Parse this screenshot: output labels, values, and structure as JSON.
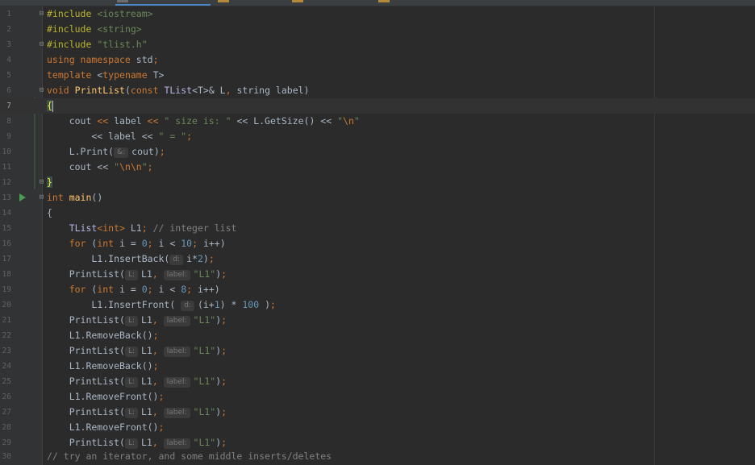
{
  "editor": {
    "tabs": [
      {
        "active": true
      },
      {
        "active": false
      },
      {
        "active": false
      },
      {
        "active": false
      }
    ],
    "colors": {
      "background": "#2b2b2b",
      "keyword": "#cc7832",
      "string": "#6a8759",
      "number": "#6897bb",
      "function": "#ffc66d",
      "comment": "#808080",
      "preprocessor": "#bbb529"
    },
    "line_numbers": [
      "1",
      "2",
      "3",
      "4",
      "5",
      "6",
      "7",
      "8",
      "9",
      "10",
      "11",
      "12",
      "13",
      "14",
      "15",
      "16",
      "17",
      "18",
      "19",
      "20",
      "21",
      "22",
      "23",
      "24",
      "25",
      "26",
      "27",
      "28",
      "29",
      "30"
    ],
    "current_line": "7",
    "run_icon_line": "13",
    "run_icon": "run-play-icon",
    "fold_icon": "fold-icon",
    "hints": {
      "os": "&:",
      "d": "d:",
      "L": "L:",
      "label": "label:"
    },
    "code": {
      "l1_directive": "#include",
      "l1_arg": "<iostream>",
      "l2_directive": "#include",
      "l2_arg": "<string>",
      "l3_directive": "#include",
      "l3_arg": "\"tlist.h\"",
      "l4_kw": "using namespace",
      "l4_rest": " std",
      "l4_semi": ";",
      "l5_kw": "template",
      "l5_open": " <",
      "l5_tn": "typename",
      "l5_rest": " T>",
      "l6_kw": "void",
      "l6_fn": "PrintList",
      "l6_p1": "(",
      "l6_const": "const",
      "l6_type": " TList",
      "l6_tmpl": "<T>& L",
      "l6_comma": ",",
      "l6_rest": " string label)",
      "l7_brace": "{",
      "l8_a": "    cout ",
      "l8_op1": "<<",
      "l8_b": " label ",
      "l8_op2": "<<",
      "l8_str": " \" size is: \"",
      "l8_c": " << L.GetSize() << ",
      "l8_str2a": "\"",
      "l8_esc": "\\n",
      "l8_str2b": "\"",
      "l9_a": "        << label << ",
      "l9_str": "\" = \"",
      "l9_semi": ";",
      "l10_a": "    L.Print(",
      "l10_b": "cout)",
      "l10_semi": ";",
      "l11_a": "    cout << ",
      "l11_q1": "\"",
      "l11_esc": "\\n\\n",
      "l11_q2": "\"",
      "l11_semi": ";",
      "l12_brace": "}",
      "l13_kw": "int",
      "l13_fn": " main",
      "l13_rest": "()",
      "l14_brace": "{",
      "l15_a": "    TList",
      "l15_tmpl": "<int>",
      "l15_b": " L1",
      "l15_semi": ";",
      "l15_cmt": " // integer list",
      "l16_kw": "    for",
      "l16_a": " (",
      "l16_int": "int",
      "l16_b": " i = ",
      "l16_n0": "0",
      "l16_s1": ";",
      "l16_c": " i < ",
      "l16_n10": "10",
      "l16_s2": ";",
      "l16_d": " i++)",
      "l17_a": "        L1.InsertBack(",
      "l17_b": "i*",
      "l17_n": "2",
      "l17_c": ")",
      "l17_semi": ";",
      "l18_a": "    PrintList(",
      "l18_b": "L1",
      "l18_comma": ",",
      "l18_str": "\"L1\"",
      "l18_c": ")",
      "l18_semi": ";",
      "l19_kw": "    for",
      "l19_a": " (",
      "l19_int": "int",
      "l19_b": " i = ",
      "l19_n0": "0",
      "l19_s1": ";",
      "l19_c": " i < ",
      "l19_n8": "8",
      "l19_s2": ";",
      "l19_d": " i++)",
      "l20_a": "        L1.InsertFront(",
      "l20_b": "(i+",
      "l20_n1": "1",
      "l20_c": ") * ",
      "l20_n100": "100",
      "l20_d": " )",
      "l20_semi": ";",
      "print_a": "    PrintList(",
      "print_b": "L1",
      "print_comma": ",",
      "print_str": "\"L1\"",
      "print_c": ")",
      "semi": ";",
      "l22": "    L1.RemoveBack()",
      "l24": "    L1.RemoveBack()",
      "l26": "    L1.RemoveFront()",
      "l28": "    L1.RemoveFront()",
      "l30_cmt": "// try an iterator, and some middle inserts/deletes"
    }
  }
}
